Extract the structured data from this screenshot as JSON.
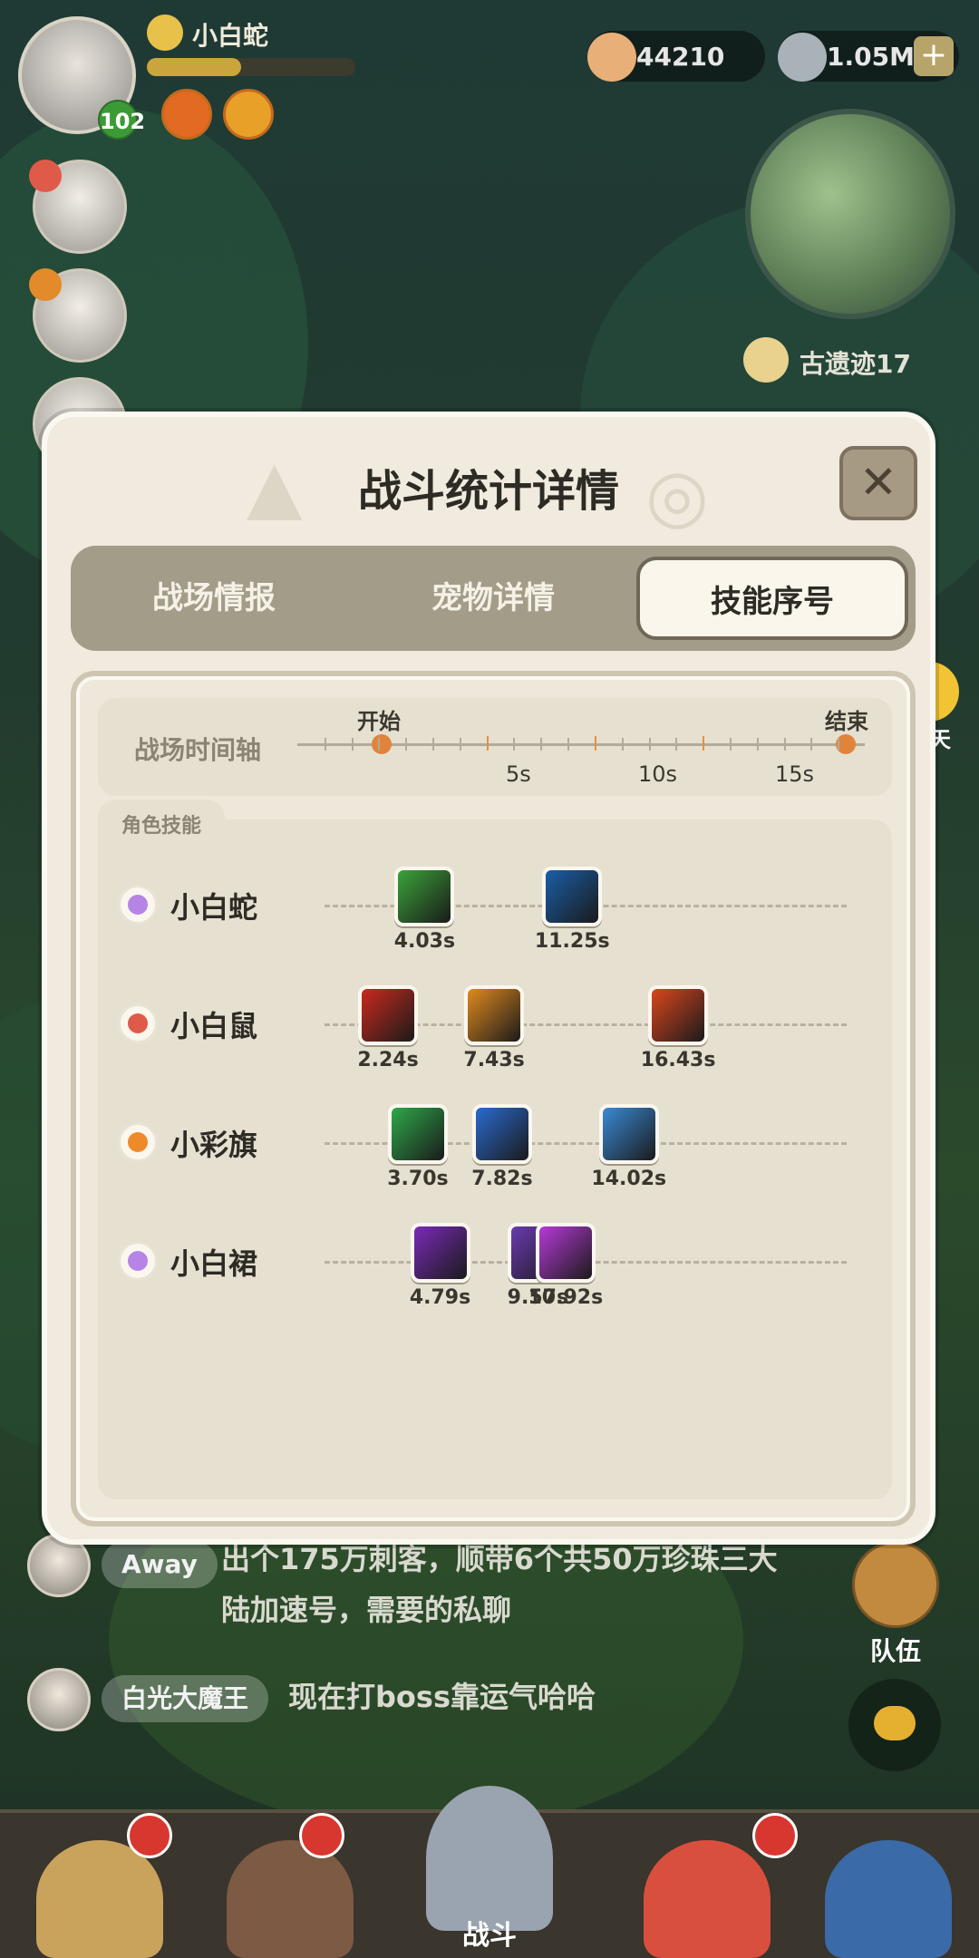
{
  "hud": {
    "player_name": "小白蛇",
    "level": "102",
    "exp_progress": 0.45,
    "shells": "44210",
    "pearls": "1.05M",
    "location": "古遗迹17"
  },
  "modal": {
    "title": "战斗统计详情",
    "close_label": "✕",
    "tabs": [
      "战场情报",
      "宠物详情",
      "技能序号"
    ],
    "active_tab": "技能序号"
  },
  "timeline": {
    "label": "战场时间轴",
    "start_label": "开始",
    "end_label": "结束",
    "ticks": [
      "5s",
      "10s",
      "15s"
    ]
  },
  "skills": {
    "section_label": "角色技能",
    "rows": [
      {
        "name": "小白蛇",
        "color": "#b684e6",
        "casts": [
          {
            "time": "4.03s",
            "t": 4.03,
            "icon_color": "#3aa33a"
          },
          {
            "time": "11.25s",
            "t": 11.25,
            "icon_color": "#1a5ea8"
          }
        ]
      },
      {
        "name": "小白鼠",
        "color": "#e05a4a",
        "casts": [
          {
            "time": "2.24s",
            "t": 2.24,
            "icon_color": "#c92a1e"
          },
          {
            "time": "7.43s",
            "t": 7.43,
            "icon_color": "#e08a1e"
          },
          {
            "time": "16.43s",
            "t": 16.43,
            "icon_color": "#d9461e"
          }
        ]
      },
      {
        "name": "小彩旗",
        "color": "#ee8a2a",
        "casts": [
          {
            "time": "3.70s",
            "t": 3.7,
            "icon_color": "#2ea84a"
          },
          {
            "time": "7.82s",
            "t": 7.82,
            "icon_color": "#2a6ad0"
          },
          {
            "time": "14.02s",
            "t": 14.02,
            "icon_color": "#3a8ad6"
          }
        ]
      },
      {
        "name": "小白裙",
        "color": "#b684e6",
        "casts": [
          {
            "time": "4.79s",
            "t": 4.79,
            "icon_color": "#7a2ab8"
          },
          {
            "time": "9.57s",
            "t": 9.57,
            "icon_color": "#6a3ab0"
          },
          {
            "time": "10.92s",
            "t": 10.92,
            "icon_color": "#b63ad8"
          }
        ]
      }
    ]
  },
  "chat_float_label": "聊天",
  "chat": [
    {
      "tag": "Away",
      "message": "出个175万刺客，顺带6个共50万珍珠三大陆加速号，需要的私聊"
    },
    {
      "tag": "白光大魔王",
      "message": "现在打boss靠运气哈哈"
    }
  ],
  "team_label": "队伍",
  "bottom_nav": {
    "battle_label": "战斗"
  }
}
